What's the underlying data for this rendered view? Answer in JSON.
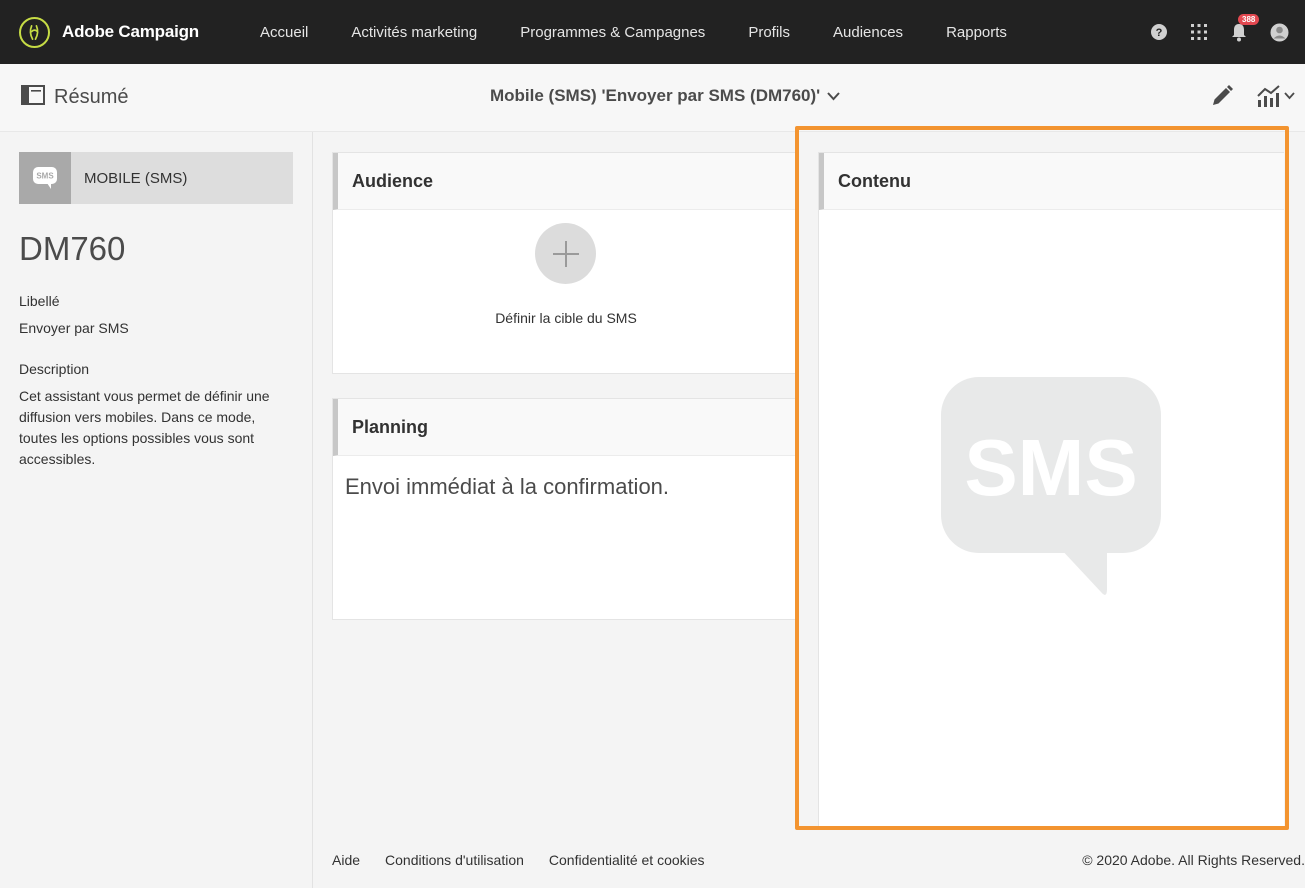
{
  "app": {
    "name": "Adobe Campaign"
  },
  "nav": {
    "items": [
      {
        "label": "Accueil"
      },
      {
        "label": "Activités marketing"
      },
      {
        "label": "Programmes & Campagnes"
      },
      {
        "label": "Profils"
      },
      {
        "label": "Audiences"
      },
      {
        "label": "Rapports"
      }
    ],
    "notification_count": "388",
    "icons": [
      "help-icon",
      "apps-grid-icon",
      "bell-icon",
      "user-avatar-icon"
    ]
  },
  "subheader": {
    "summary_label": "Résumé",
    "delivery_title": "Mobile (SMS) 'Envoyer par SMS (DM760)'"
  },
  "left": {
    "channel_badge_text": "SMS",
    "channel_label": "MOBILE (SMS)",
    "delivery_id": "DM760",
    "label_caption": "Libellé",
    "label_value": "Envoyer par SMS",
    "description_caption": "Description",
    "description_value": "Cet assistant vous permet de définir une diffusion vers mobiles. Dans ce mode, toutes les options possibles vous sont accessibles."
  },
  "audience": {
    "title": "Audience",
    "action_text": "Définir la cible du SMS"
  },
  "planning": {
    "title": "Planning",
    "text": "Envoi immédiat à la confirmation."
  },
  "content": {
    "title": "Contenu",
    "placeholder_text": "SMS"
  },
  "footer": {
    "links": [
      {
        "label": "Aide"
      },
      {
        "label": "Conditions d'utilisation"
      },
      {
        "label": "Confidentialité et cookies"
      }
    ],
    "copyright": "© 2020 Adobe. All Rights Reserved."
  },
  "colors": {
    "topbar": "#222222",
    "brand_accent": "#c6dc45",
    "highlight_frame": "#f39430",
    "badge": "#e34850"
  }
}
